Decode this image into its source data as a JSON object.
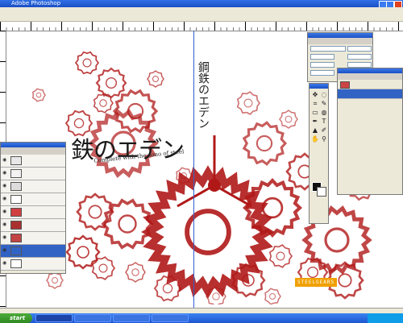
{
  "window": {
    "title": "Adobe Photoshop"
  },
  "colors": {
    "accent": "#3163c5",
    "gear_red": "#b01818",
    "taskbar": "#1e56d0",
    "logo": "#f0a000"
  },
  "canvas": {
    "title_jp": "鉄のエデン",
    "subtitle_en": "Complete with the sono of steel",
    "title_vert": "鋼鉄のエデン",
    "logo_text": "STEELGEARS"
  },
  "layers_palette": {
    "rows": [
      {
        "selected": false,
        "thumb_color": "#e8e8e8"
      },
      {
        "selected": false,
        "thumb_color": "#f2f2f2"
      },
      {
        "selected": false,
        "thumb_color": "#dddddd"
      },
      {
        "selected": false,
        "thumb_color": "#ffffff"
      },
      {
        "selected": false,
        "thumb_color": "#d04040"
      },
      {
        "selected": false,
        "thumb_color": "#aa3030"
      },
      {
        "selected": false,
        "thumb_color": "#c24444"
      },
      {
        "selected": true,
        "thumb_color": "#3163c5"
      },
      {
        "selected": false,
        "thumb_color": "#ffffff"
      }
    ]
  },
  "tools": [
    "move-tool",
    "lasso-tool",
    "crop-tool",
    "brush-tool",
    "eraser-tool",
    "blur-tool",
    "pen-tool",
    "type-tool",
    "shape-tool",
    "eyedropper-tool",
    "hand-tool",
    "zoom-tool"
  ],
  "taskbar": {
    "start_label": "start"
  }
}
